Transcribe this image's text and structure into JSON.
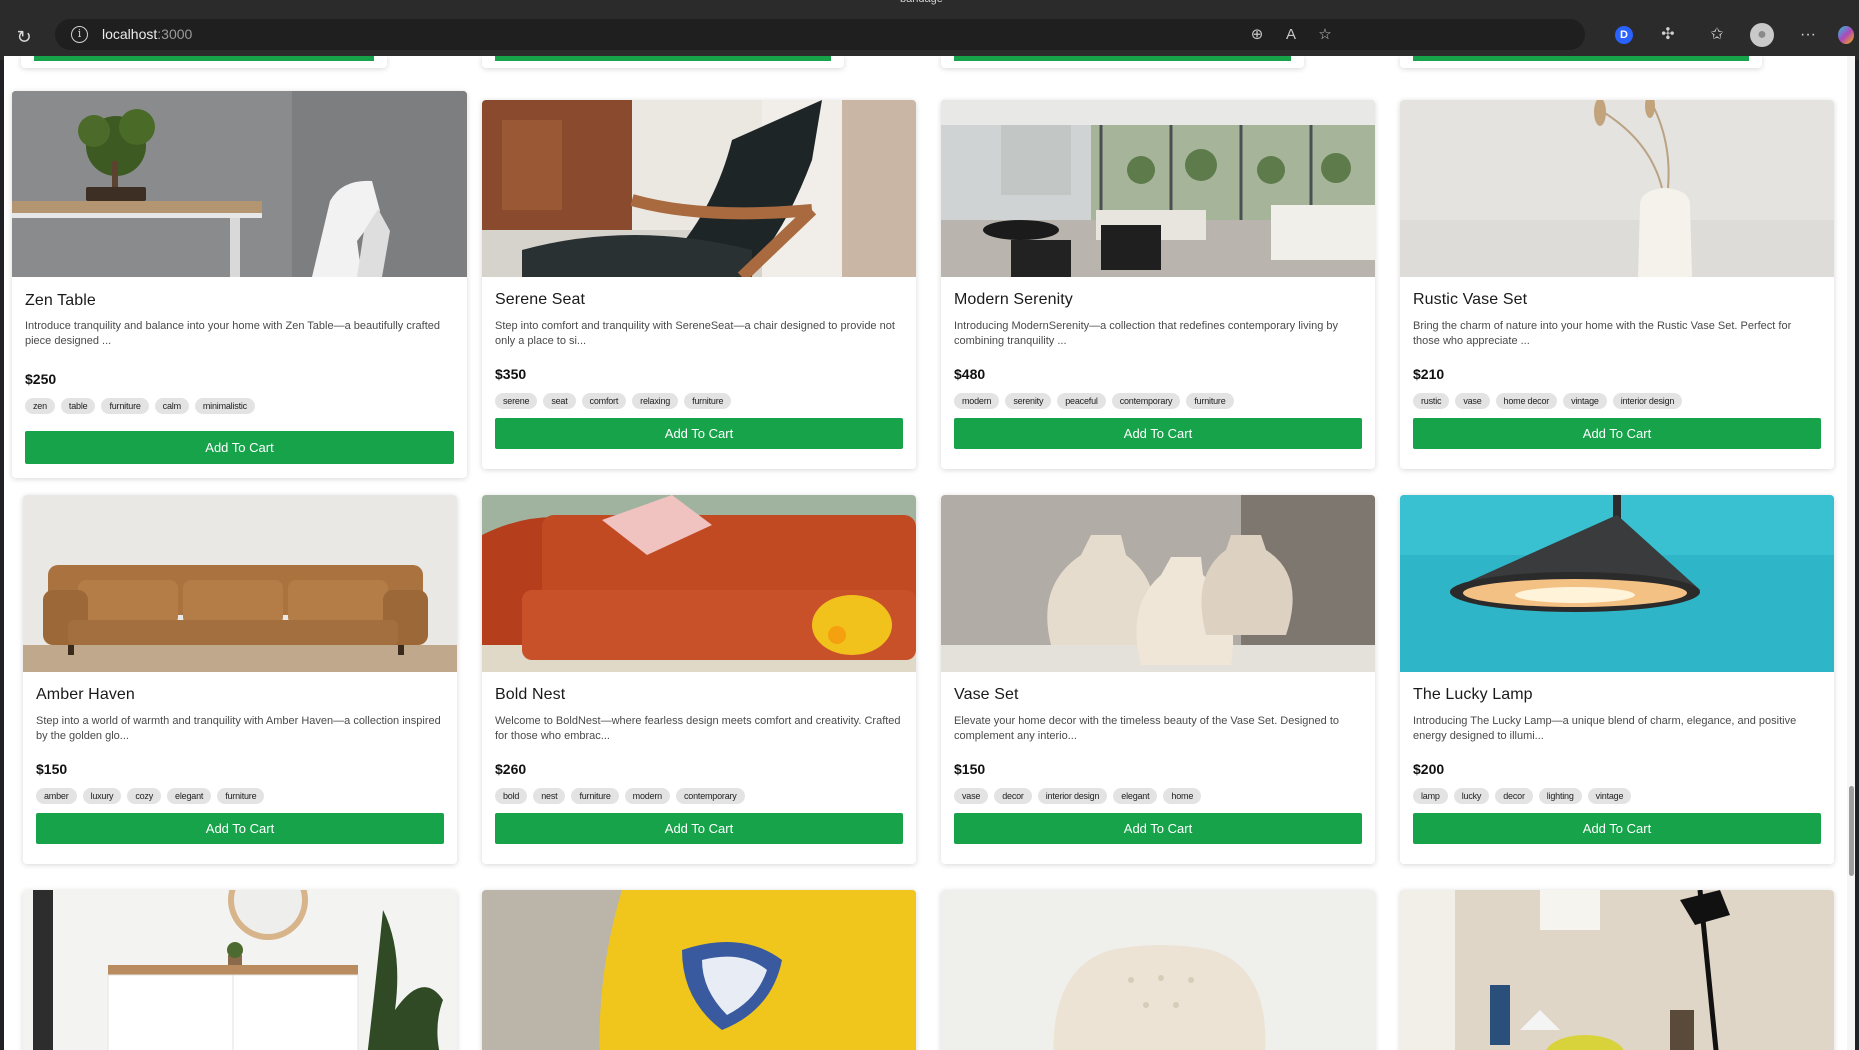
{
  "browser": {
    "window_title": "bandage",
    "url_host": "localhost",
    "url_port": ":3000",
    "extension_badge": "D"
  },
  "colors": {
    "accent_green": "#16a34a",
    "tag_bg": "#e3e3e3"
  },
  "products": [
    {
      "title": "Zen Table",
      "description": "Introduce tranquility and balance into your home with Zen Table—a beautifully crafted piece designed ...",
      "price": "$250",
      "tags": [
        "zen",
        "table",
        "furniture",
        "calm",
        "minimalistic"
      ],
      "button": "Add To Cart",
      "image": "bonsai-table"
    },
    {
      "title": "Serene Seat",
      "description": "Step into comfort and tranquility with SereneSeat—a chair designed to provide not only a place to si...",
      "price": "$350",
      "tags": [
        "serene",
        "seat",
        "comfort",
        "relaxing",
        "furniture"
      ],
      "button": "Add To Cart",
      "image": "lounge-chair"
    },
    {
      "title": "Modern Serenity",
      "description": "Introducing ModernSerenity—a collection that redefines contemporary living by combining tranquility ...",
      "price": "$480",
      "tags": [
        "modern",
        "serenity",
        "peaceful",
        "contemporary",
        "furniture"
      ],
      "button": "Add To Cart",
      "image": "living-room"
    },
    {
      "title": "Rustic Vase Set",
      "description": "Bring the charm of nature into your home with the Rustic Vase Set. Perfect for those who appreciate ...",
      "price": "$210",
      "tags": [
        "rustic",
        "vase",
        "home decor",
        "vintage",
        "interior design"
      ],
      "button": "Add To Cart",
      "image": "white-vase"
    },
    {
      "title": "Amber Haven",
      "description": "Step into a world of warmth and tranquility with Amber Haven—a collection inspired by the golden glo...",
      "price": "$150",
      "tags": [
        "amber",
        "luxury",
        "cozy",
        "elegant",
        "furniture"
      ],
      "button": "Add To Cart",
      "image": "leather-sofa"
    },
    {
      "title": "Bold Nest",
      "description": "Welcome to BoldNest—where fearless design meets comfort and creativity. Crafted for those who embrac...",
      "price": "$260",
      "tags": [
        "bold",
        "nest",
        "furniture",
        "modern",
        "contemporary"
      ],
      "button": "Add To Cart",
      "image": "orange-sofa"
    },
    {
      "title": "Vase Set",
      "description": "Elevate your home decor with the timeless beauty of the Vase Set. Designed to complement any interio...",
      "price": "$150",
      "tags": [
        "vase",
        "decor",
        "interior design",
        "elegant",
        "home"
      ],
      "button": "Add To Cart",
      "image": "clay-vases"
    },
    {
      "title": "The Lucky Lamp",
      "description": "Introducing The Lucky Lamp—a unique blend of charm, elegance, and positive energy designed to illumi...",
      "price": "$200",
      "tags": [
        "lamp",
        "lucky",
        "decor",
        "lighting",
        "vintage"
      ],
      "button": "Add To Cart",
      "image": "pendant-lamp"
    }
  ]
}
